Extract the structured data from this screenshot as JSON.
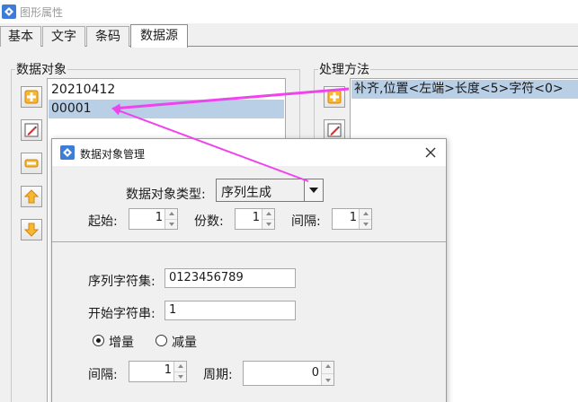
{
  "window": {
    "title": "图形属性"
  },
  "tabs": [
    {
      "label": "基本"
    },
    {
      "label": "文字"
    },
    {
      "label": "条码"
    },
    {
      "label": "数据源",
      "active": true
    }
  ],
  "data_objects": {
    "group_label": "数据对象",
    "items": [
      {
        "label": "20210412",
        "selected": false
      },
      {
        "label": "00001",
        "selected": true
      }
    ],
    "buttons": [
      "add-icon",
      "edit-icon",
      "remove-icon",
      "move-up-icon",
      "move-down-icon"
    ]
  },
  "processing": {
    "group_label": "处理方法",
    "items": [
      {
        "label": "补齐,位置<左端>长度<5>字符<0>",
        "selected": true
      }
    ],
    "buttons": [
      "add-icon",
      "edit-icon"
    ]
  },
  "dialog": {
    "title": "数据对象管理",
    "type_label": "数据对象类型:",
    "type_value": "序列生成",
    "start_label": "起始:",
    "start_value": "1",
    "copies_label": "份数:",
    "copies_value": "1",
    "interval_label": "间隔:",
    "interval_value": "1",
    "charset_label": "序列字符集:",
    "charset_value": "0123456789",
    "start_string_label": "开始字符串:",
    "start_string_value": "1",
    "increment_label": "增量",
    "decrement_label": "减量",
    "increment_selected": true,
    "step_label": "间隔:",
    "step_value": "1",
    "period_label": "周期:",
    "period_value": "0"
  },
  "colors": {
    "selection": "#b9cfe6",
    "arrow": "#ee44ee",
    "button_plus": "#f5a623",
    "button_minus": "#f5a623"
  }
}
